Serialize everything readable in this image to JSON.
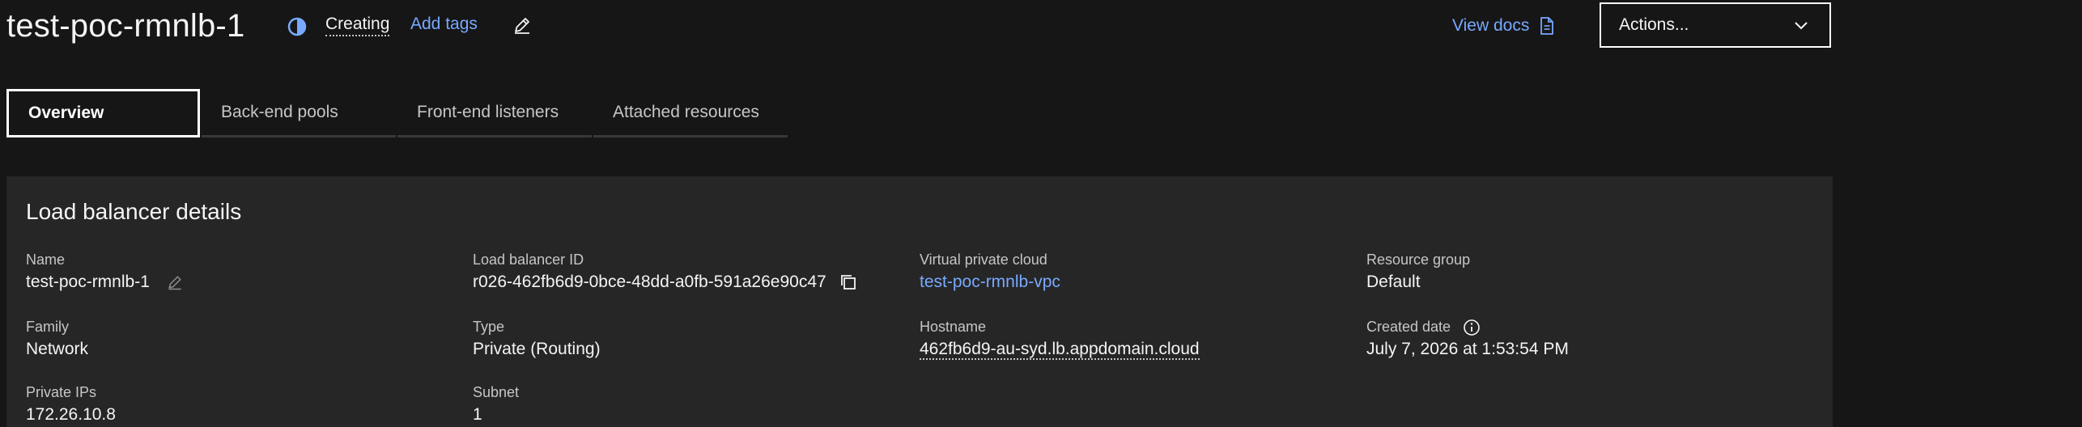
{
  "header": {
    "title": "test-poc-rmnlb-1",
    "status": "Creating",
    "add_tags": "Add tags",
    "view_docs": "View docs",
    "actions_label": "Actions..."
  },
  "tabs": [
    {
      "label": "Overview",
      "active": true
    },
    {
      "label": "Back-end pools",
      "active": false
    },
    {
      "label": "Front-end listeners",
      "active": false
    },
    {
      "label": "Attached resources",
      "active": false
    }
  ],
  "details": {
    "title": "Load balancer details",
    "name_label": "Name",
    "name_value": "test-poc-rmnlb-1",
    "id_label": "Load balancer ID",
    "id_value": "r026-462fb6d9-0bce-48dd-a0fb-591a26e90c47",
    "vpc_label": "Virtual private cloud",
    "vpc_value": "test-poc-rmnlb-vpc",
    "rg_label": "Resource group",
    "rg_value": "Default",
    "family_label": "Family",
    "family_value": "Network",
    "type_label": "Type",
    "type_value": "Private (Routing)",
    "hostname_label": "Hostname",
    "hostname_value": "462fb6d9-au-syd.lb.appdomain.cloud",
    "created_label": "Created date",
    "created_value": "July 7, 2026 at 1:53:54 PM",
    "ips_label": "Private IPs",
    "ips_value": "172.26.10.8",
    "subnet_label": "Subnet",
    "subnet_value": "1"
  },
  "colors": {
    "background": "#161616",
    "panel": "#262626",
    "link": "#78a9ff",
    "text": "#f4f4f4",
    "label": "#c6c6c6"
  },
  "icons": [
    "status-in-progress-icon",
    "edit-icon",
    "document-icon",
    "chevron-down-icon",
    "copy-icon",
    "information-icon"
  ]
}
